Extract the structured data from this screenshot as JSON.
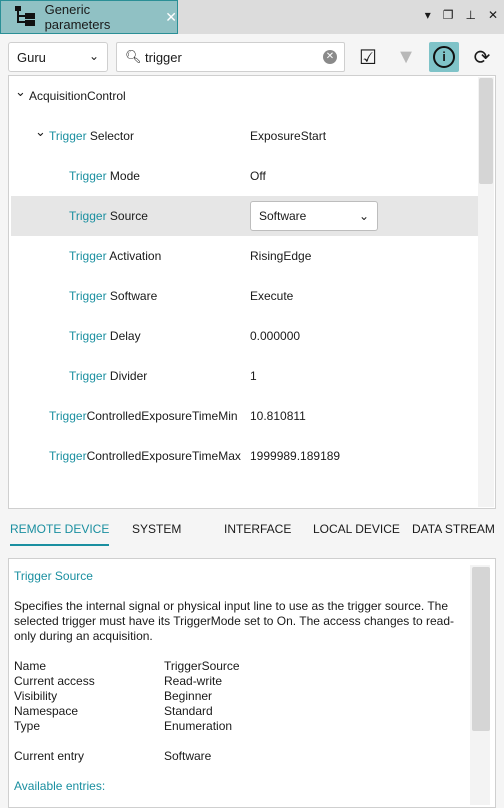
{
  "window": {
    "tab_title": "Generic parameters",
    "tab_icon": "tree-icon",
    "buttons": [
      "dropdown-icon",
      "restore-icon",
      "pin-icon",
      "close-icon"
    ]
  },
  "toolbar": {
    "visibility": "Guru",
    "search_value": "trigger",
    "icons": [
      "select-all-icon",
      "filter-icon",
      "info-icon",
      "refresh-icon"
    ],
    "accent": "#1a8fa0",
    "info_active_bg": "#7fc3c8"
  },
  "tree": {
    "rows": [
      {
        "hl": "",
        "rest": "AcquisitionControl",
        "value": "",
        "level": 0,
        "expanded": true
      },
      {
        "hl": "Trigger",
        "rest": " Selector",
        "value": "ExposureStart",
        "level": 1,
        "expanded": true
      },
      {
        "hl": "Trigger",
        "rest": " Mode",
        "value": "Off",
        "level": 2
      },
      {
        "hl": "Trigger",
        "rest": " Source",
        "value": "Software",
        "level": 2,
        "selected": true,
        "editor": "dropdown"
      },
      {
        "hl": "Trigger",
        "rest": " Activation",
        "value": "RisingEdge",
        "level": 2
      },
      {
        "hl": "Trigger",
        "rest": " Software",
        "value": "Execute",
        "level": 2
      },
      {
        "hl": "Trigger",
        "rest": " Delay",
        "value": "0.000000",
        "level": 2
      },
      {
        "hl": "Trigger",
        "rest": " Divider",
        "value": "1",
        "level": 2
      },
      {
        "hl": "Trigger",
        "rest": "ControlledExposureTimeMin",
        "value": "10.810811",
        "level": 1
      },
      {
        "hl": "Trigger",
        "rest": "ControlledExposureTimeMax",
        "value": "1999989.189189",
        "level": 1
      }
    ]
  },
  "tabs": [
    "REMOTE DEVICE",
    "SYSTEM",
    "INTERFACE",
    "LOCAL DEVICE",
    "DATA STREAM"
  ],
  "info": {
    "title": "Trigger Source",
    "description": "Specifies the internal signal or physical input line to use as the trigger source. The selected trigger must have its TriggerMode set to On. The access changes to read-only during an acquisition.",
    "props": [
      {
        "k": "Name",
        "v": "TriggerSource"
      },
      {
        "k": "Current access",
        "v": "Read-write"
      },
      {
        "k": "Visibility",
        "v": "Beginner"
      },
      {
        "k": "Namespace",
        "v": "Standard"
      },
      {
        "k": "Type",
        "v": "Enumeration"
      }
    ],
    "current_entry_label": "Current entry",
    "current_entry_value": "Software",
    "available_label": "Available entries:"
  }
}
